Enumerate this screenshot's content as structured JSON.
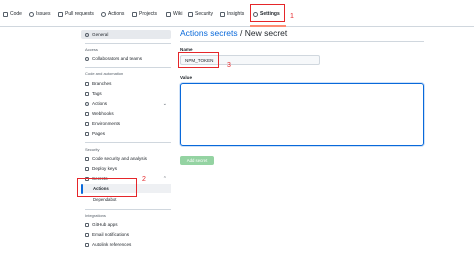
{
  "topnav": {
    "tabs": [
      {
        "label": "Code",
        "icon": "code-icon"
      },
      {
        "label": "Issues",
        "icon": "issue-icon"
      },
      {
        "label": "Pull requests",
        "icon": "pull-request-icon"
      },
      {
        "label": "Actions",
        "icon": "play-icon"
      },
      {
        "label": "Projects",
        "icon": "table-icon"
      },
      {
        "label": "Wiki",
        "icon": "book-icon"
      },
      {
        "label": "Security",
        "icon": "shield-icon"
      },
      {
        "label": "Insights",
        "icon": "graph-icon"
      },
      {
        "label": "Settings",
        "icon": "gear-icon"
      }
    ],
    "active_tab": "Settings"
  },
  "annotations": {
    "n1": "1",
    "n2": "2",
    "n3": "3"
  },
  "sidebar": {
    "general": "General",
    "access_head": "Access",
    "collaborators": "Collaborators and teams",
    "code_head": "Code and automation",
    "branches": "Branches",
    "tags": "Tags",
    "actions": "Actions",
    "webhooks": "Webhooks",
    "environments": "Environments",
    "pages": "Pages",
    "security_head": "Security",
    "code_security": "Code security and analysis",
    "deploy_keys": "Deploy keys",
    "secrets": "Secrets",
    "secrets_actions": "Actions",
    "secrets_dependabot": "Dependabot",
    "integrations_head": "Integrations",
    "github_apps": "GitHub apps",
    "email": "Email notifications",
    "autolink": "Autolink references"
  },
  "main": {
    "crumb_link": "Actions secrets",
    "crumb_rest": " / New secret",
    "name_label": "Name",
    "name_value": "NPM_TOKEN",
    "value_label": "Value",
    "add_button": "Add secret"
  },
  "colors": {
    "accent": "#0969da",
    "annotation": "#e5262a",
    "button_disabled": "#94d3a2",
    "tab_underline": "#fd8c73"
  }
}
